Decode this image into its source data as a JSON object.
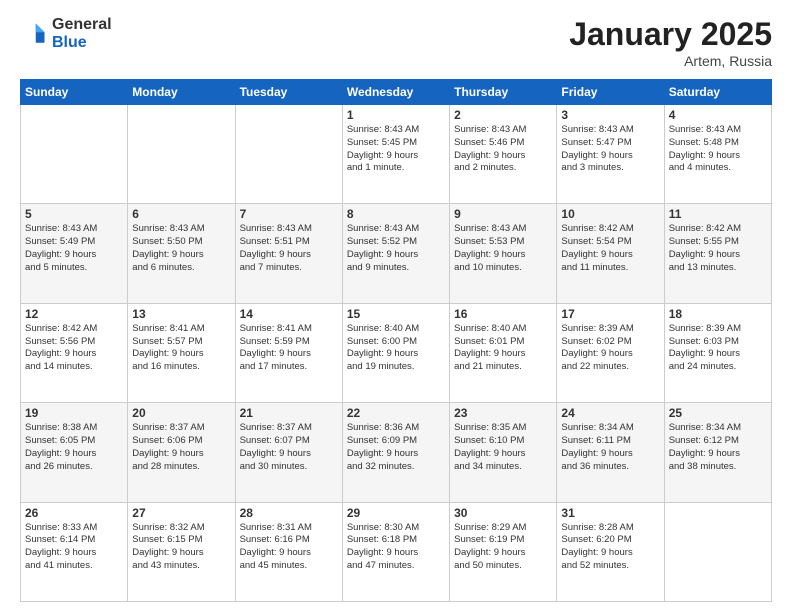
{
  "logo": {
    "general": "General",
    "blue": "Blue"
  },
  "header": {
    "month": "January 2025",
    "location": "Artem, Russia"
  },
  "weekdays": [
    "Sunday",
    "Monday",
    "Tuesday",
    "Wednesday",
    "Thursday",
    "Friday",
    "Saturday"
  ],
  "weeks": [
    [
      {
        "day": "",
        "content": ""
      },
      {
        "day": "",
        "content": ""
      },
      {
        "day": "",
        "content": ""
      },
      {
        "day": "1",
        "content": "Sunrise: 8:43 AM\nSunset: 5:45 PM\nDaylight: 9 hours\nand 1 minute."
      },
      {
        "day": "2",
        "content": "Sunrise: 8:43 AM\nSunset: 5:46 PM\nDaylight: 9 hours\nand 2 minutes."
      },
      {
        "day": "3",
        "content": "Sunrise: 8:43 AM\nSunset: 5:47 PM\nDaylight: 9 hours\nand 3 minutes."
      },
      {
        "day": "4",
        "content": "Sunrise: 8:43 AM\nSunset: 5:48 PM\nDaylight: 9 hours\nand 4 minutes."
      }
    ],
    [
      {
        "day": "5",
        "content": "Sunrise: 8:43 AM\nSunset: 5:49 PM\nDaylight: 9 hours\nand 5 minutes."
      },
      {
        "day": "6",
        "content": "Sunrise: 8:43 AM\nSunset: 5:50 PM\nDaylight: 9 hours\nand 6 minutes."
      },
      {
        "day": "7",
        "content": "Sunrise: 8:43 AM\nSunset: 5:51 PM\nDaylight: 9 hours\nand 7 minutes."
      },
      {
        "day": "8",
        "content": "Sunrise: 8:43 AM\nSunset: 5:52 PM\nDaylight: 9 hours\nand 9 minutes."
      },
      {
        "day": "9",
        "content": "Sunrise: 8:43 AM\nSunset: 5:53 PM\nDaylight: 9 hours\nand 10 minutes."
      },
      {
        "day": "10",
        "content": "Sunrise: 8:42 AM\nSunset: 5:54 PM\nDaylight: 9 hours\nand 11 minutes."
      },
      {
        "day": "11",
        "content": "Sunrise: 8:42 AM\nSunset: 5:55 PM\nDaylight: 9 hours\nand 13 minutes."
      }
    ],
    [
      {
        "day": "12",
        "content": "Sunrise: 8:42 AM\nSunset: 5:56 PM\nDaylight: 9 hours\nand 14 minutes."
      },
      {
        "day": "13",
        "content": "Sunrise: 8:41 AM\nSunset: 5:57 PM\nDaylight: 9 hours\nand 16 minutes."
      },
      {
        "day": "14",
        "content": "Sunrise: 8:41 AM\nSunset: 5:59 PM\nDaylight: 9 hours\nand 17 minutes."
      },
      {
        "day": "15",
        "content": "Sunrise: 8:40 AM\nSunset: 6:00 PM\nDaylight: 9 hours\nand 19 minutes."
      },
      {
        "day": "16",
        "content": "Sunrise: 8:40 AM\nSunset: 6:01 PM\nDaylight: 9 hours\nand 21 minutes."
      },
      {
        "day": "17",
        "content": "Sunrise: 8:39 AM\nSunset: 6:02 PM\nDaylight: 9 hours\nand 22 minutes."
      },
      {
        "day": "18",
        "content": "Sunrise: 8:39 AM\nSunset: 6:03 PM\nDaylight: 9 hours\nand 24 minutes."
      }
    ],
    [
      {
        "day": "19",
        "content": "Sunrise: 8:38 AM\nSunset: 6:05 PM\nDaylight: 9 hours\nand 26 minutes."
      },
      {
        "day": "20",
        "content": "Sunrise: 8:37 AM\nSunset: 6:06 PM\nDaylight: 9 hours\nand 28 minutes."
      },
      {
        "day": "21",
        "content": "Sunrise: 8:37 AM\nSunset: 6:07 PM\nDaylight: 9 hours\nand 30 minutes."
      },
      {
        "day": "22",
        "content": "Sunrise: 8:36 AM\nSunset: 6:09 PM\nDaylight: 9 hours\nand 32 minutes."
      },
      {
        "day": "23",
        "content": "Sunrise: 8:35 AM\nSunset: 6:10 PM\nDaylight: 9 hours\nand 34 minutes."
      },
      {
        "day": "24",
        "content": "Sunrise: 8:34 AM\nSunset: 6:11 PM\nDaylight: 9 hours\nand 36 minutes."
      },
      {
        "day": "25",
        "content": "Sunrise: 8:34 AM\nSunset: 6:12 PM\nDaylight: 9 hours\nand 38 minutes."
      }
    ],
    [
      {
        "day": "26",
        "content": "Sunrise: 8:33 AM\nSunset: 6:14 PM\nDaylight: 9 hours\nand 41 minutes."
      },
      {
        "day": "27",
        "content": "Sunrise: 8:32 AM\nSunset: 6:15 PM\nDaylight: 9 hours\nand 43 minutes."
      },
      {
        "day": "28",
        "content": "Sunrise: 8:31 AM\nSunset: 6:16 PM\nDaylight: 9 hours\nand 45 minutes."
      },
      {
        "day": "29",
        "content": "Sunrise: 8:30 AM\nSunset: 6:18 PM\nDaylight: 9 hours\nand 47 minutes."
      },
      {
        "day": "30",
        "content": "Sunrise: 8:29 AM\nSunset: 6:19 PM\nDaylight: 9 hours\nand 50 minutes."
      },
      {
        "day": "31",
        "content": "Sunrise: 8:28 AM\nSunset: 6:20 PM\nDaylight: 9 hours\nand 52 minutes."
      },
      {
        "day": "",
        "content": ""
      }
    ]
  ]
}
